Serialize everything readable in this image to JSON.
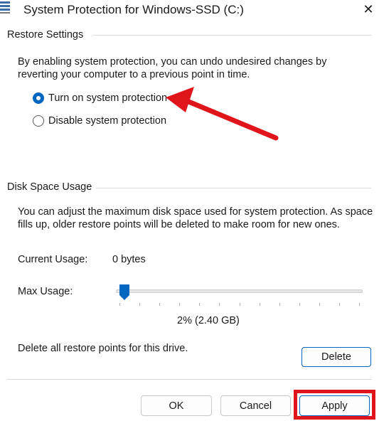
{
  "window": {
    "title": "System Protection for Windows-SSD (C:)",
    "close_glyph": "✕"
  },
  "restore_settings": {
    "group_title": "Restore Settings",
    "description_line1": "By enabling system protection, you can undo undesired changes by",
    "description_line2": "reverting your computer to a previous point in time.",
    "options": [
      {
        "label": "Turn on system protection",
        "selected": true
      },
      {
        "label": "Disable system protection",
        "selected": false
      }
    ]
  },
  "disk_space": {
    "group_title": "Disk Space Usage",
    "description_line1": "You can adjust the maximum disk space used for system protection. As space",
    "description_line2": "fills up, older restore points will be deleted to make room for new ones.",
    "current_usage_label": "Current Usage:",
    "current_usage_value": "0 bytes",
    "max_usage_label": "Max Usage:",
    "max_usage_percent": 2,
    "max_usage_readout": "2% (2.40 GB)",
    "delete_text": "Delete all restore points for this drive.",
    "delete_button": "Delete"
  },
  "footer": {
    "ok_button": "OK",
    "cancel_button": "Cancel",
    "apply_button": "Apply"
  },
  "colors": {
    "accent": "#0067c0",
    "annotation_red": "#e0141b"
  },
  "icons": {
    "window_icon": "system-protection-icon",
    "close_icon": "close-icon",
    "annotation": "red-arrow-annotation"
  }
}
